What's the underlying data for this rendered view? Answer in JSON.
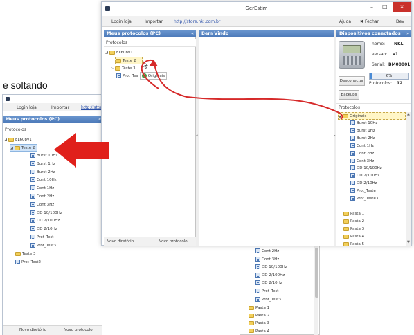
{
  "caption": "e soltando",
  "window": {
    "title": "GerEstim",
    "controls": [
      "–",
      "□",
      "✕"
    ]
  },
  "toolbar": {
    "login": "Login loja",
    "import": "Importar",
    "store_link": "http://store.nkl.com.br",
    "help": "Ajuda",
    "close": "Fechar",
    "dev": "Dev"
  },
  "left_panel": {
    "title": "Meus protocolos (PC)",
    "collapse_arrow": "«",
    "subheader": "Protocolos",
    "new_dir": "Novo diretório",
    "new_protocol": "Novo protocolo"
  },
  "main_tree": {
    "root": "EL608v1",
    "teste2": "Teste 2",
    "teste3": "Teste 3",
    "prot_test": "Prot_Tes",
    "drag_label": "Originais"
  },
  "center_panel": {
    "title": "Bem Vindo"
  },
  "right_panel": {
    "title": "Dispositivos conectados",
    "collapse_arrow": "»",
    "nome_label": "nome:",
    "nome_value": "NKL",
    "versao_label": "versao:",
    "versao_value": "v1",
    "serial_label": "Serial:",
    "serial_value": "BM00001",
    "progress": 6,
    "progress_text": "6%",
    "disconnect": "Desconectar",
    "protocols_count_label": "Protocolos:",
    "protocols_count": "12",
    "backups": "Backups",
    "subheader": "Protocolos",
    "folder_originais": "Originais",
    "items": [
      "Burst 10Hz",
      "Burst 1Hz",
      "Burst 2Hz",
      "Cont 1Hz",
      "Cont 2Hz",
      "Cont 3Hz",
      "DD 10/100Hz",
      "DD 2/100Hz",
      "DD 2/10Hz",
      "Prot_Teste",
      "Prot_Teste3"
    ],
    "folders": [
      "Pasta 1",
      "Pasta 2",
      "Pasta 3",
      "Pasta 4",
      "Pasta 5"
    ]
  },
  "bg_window": {
    "toolbar_login": "Login loja",
    "toolbar_import": "Importar",
    "toolbar_link": "http://stor",
    "panel_title": "Meus protocolos (PC)",
    "collapse_arrow": "«",
    "subheader": "Protocolos",
    "root": "EL608v1",
    "teste2": "Teste 2",
    "items": [
      "Burst 10Hz",
      "Burst 1Hz",
      "Burst 2Hz",
      "Cont 10Hz",
      "Cont 1Hz",
      "Cont 2Hz",
      "Cont 3Hz",
      "DD 10/100Hz",
      "DD 2/100Hz",
      "DD 2/10Hz",
      "Prot_Test",
      "Prot_Test3"
    ],
    "teste3": "Teste 3",
    "prot_test2": "Prot_Test2",
    "new_dir": "Novo diretório",
    "new_protocol": "Novo protocolo"
  },
  "bg_right_list": {
    "items": [
      "Cont 2Hz",
      "Cont 3Hz",
      "DD 10/100Hz",
      "DD 2/100Hz",
      "DD 2/10Hz",
      "Prot_Test",
      "Prot_Test3"
    ],
    "folders": [
      "Pasta 1",
      "Pasta 2",
      "Pasta 3",
      "Pasta 4"
    ]
  },
  "colors": {
    "panel_header": "#4a78b8",
    "red_arrow": "#e0201b",
    "drag_line": "#d62a2a",
    "close_button": "#c9312b"
  }
}
